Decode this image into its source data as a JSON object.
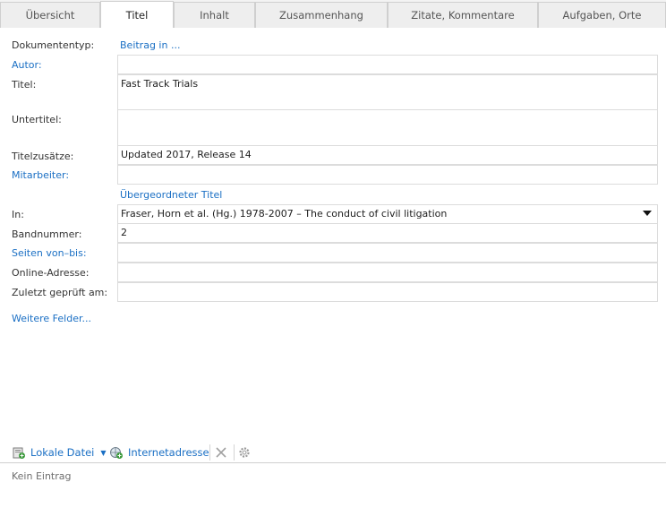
{
  "tabs": [
    {
      "label": "Übersicht"
    },
    {
      "label": "Titel"
    },
    {
      "label": "Inhalt"
    },
    {
      "label": "Zusammenhang"
    },
    {
      "label": "Zitate, Kommentare"
    },
    {
      "label": "Aufgaben, Orte"
    }
  ],
  "active_tab": "Titel",
  "form": {
    "doctype_label": "Dokumententyp:",
    "doctype_value": "Beitrag in ...",
    "author_label": "Autor:",
    "author_value": "",
    "title_label": "Titel:",
    "title_value": "Fast Track Trials",
    "subtitle_label": "Untertitel:",
    "subtitle_value": "",
    "title_suffix_label": "Titelzusätze:",
    "title_suffix_value": "Updated 2017, Release 14",
    "contributors_label": "Mitarbeiter:",
    "contributors_value": "",
    "parent_title_heading": "Übergeordneter Titel",
    "in_label": "In:",
    "in_value": "Fraser, Horn et al. (Hg.) 1978-2007 – The conduct of civil litigation",
    "volume_label": "Bandnummer:",
    "volume_value": "2",
    "pages_label": "Seiten von–bis:",
    "pages_value": "",
    "online_label": "Online-Adresse:",
    "online_value": "",
    "checked_label": "Zuletzt geprüft am:",
    "checked_value": "",
    "more_fields": "Weitere Felder..."
  },
  "attachments": {
    "local_file": "Lokale Datei",
    "internet_address": "Internetadresse",
    "empty_text": "Kein Eintrag"
  },
  "colors": {
    "link": "#1a6fc4",
    "border": "#dcdcdc",
    "tab_bg": "#eeeeee"
  }
}
